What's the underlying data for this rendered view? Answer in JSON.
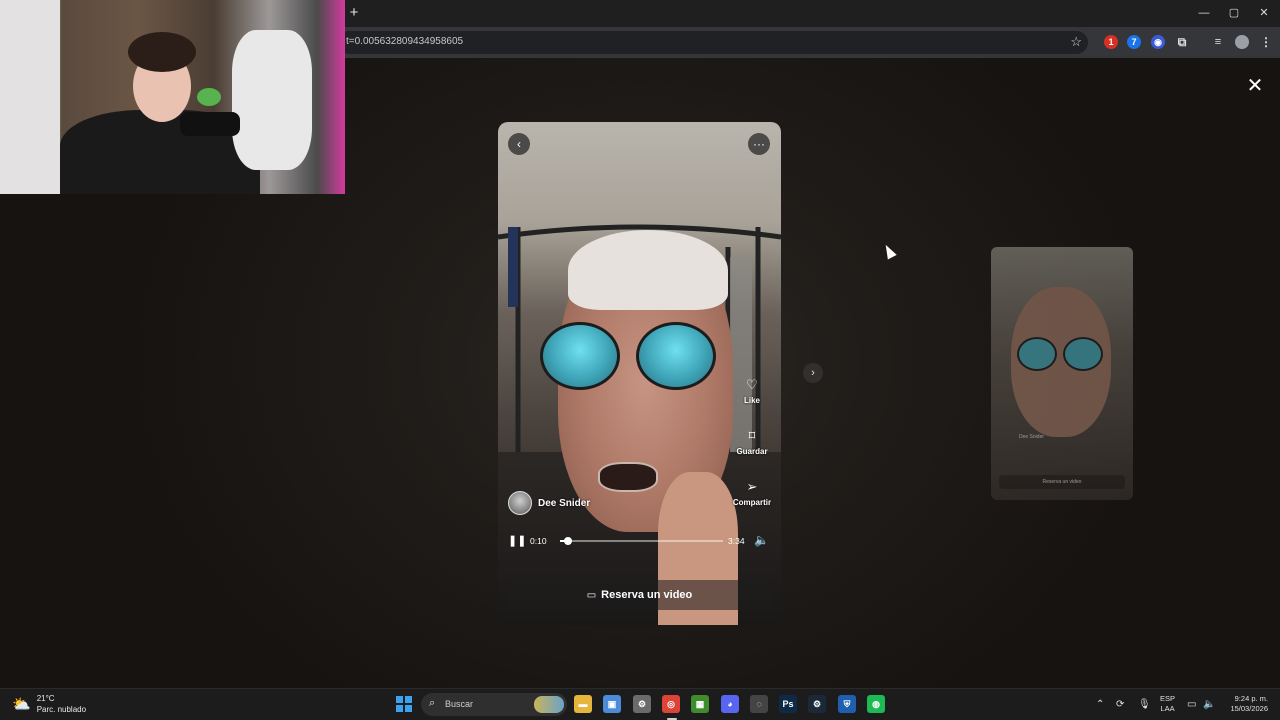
{
  "browser": {
    "new_tab": "+",
    "url": "t=0.005632809434958605",
    "window_controls": {
      "minimize": "—",
      "maximize": "▢",
      "close": "✕"
    },
    "extensions": [
      {
        "icon": "youtube-ext-icon",
        "color": "#d93025",
        "glyph": "1"
      },
      {
        "icon": "translate-ext-icon",
        "color": "#1a73e8",
        "glyph": "7"
      },
      {
        "icon": "shield-ext-icon",
        "color": "#3b5bd6",
        "glyph": "◉"
      }
    ]
  },
  "lightbox": {
    "close_glyph": "✕",
    "video": {
      "back_glyph": "‹",
      "more_glyph": "···",
      "author": "Dee Snider",
      "actions": [
        {
          "icon": "heart-icon",
          "glyph": "♡",
          "label": "Like"
        },
        {
          "icon": "bookmark-icon",
          "glyph": "⌑",
          "label": "Guardar"
        },
        {
          "icon": "send-icon",
          "glyph": "➢",
          "label": "Compartir"
        }
      ],
      "current_time": "0:10",
      "total_time": "3:34",
      "progress_fraction": 0.047,
      "play_state_glyph": "❚❚",
      "volume_glyph": "🔈",
      "cta_label": "Reserva un video",
      "cta_icon_glyph": "▭"
    },
    "next_arrow_glyph": "›",
    "next_preview": {
      "author": "Dee Snider",
      "cta_label": "Reserva un video"
    }
  },
  "taskbar": {
    "weather": {
      "temp": "21°C",
      "condition": "Parc. nublado",
      "icon_glyph": "⛅"
    },
    "search_label": "Buscar",
    "search_icon_glyph": "⌕",
    "apps": [
      {
        "name": "file-explorer-icon",
        "glyph": "▬",
        "color": "#e7b53b"
      },
      {
        "name": "store-icon",
        "glyph": "▣",
        "color": "#4c8bd8"
      },
      {
        "name": "settings-icon",
        "glyph": "⚙",
        "color": "#6b6b6b"
      },
      {
        "name": "chrome-icon",
        "glyph": "◎",
        "color": "#db4437"
      },
      {
        "name": "minecraft-icon",
        "glyph": "▦",
        "color": "#3f8c2c"
      },
      {
        "name": "discord-icon",
        "glyph": "◕",
        "color": "#5865f2"
      },
      {
        "name": "app-icon",
        "glyph": "◌",
        "color": "#444444"
      },
      {
        "name": "photoshop-icon",
        "glyph": "Ps",
        "color": "#0e2a47"
      },
      {
        "name": "steam-icon",
        "glyph": "⚙",
        "color": "#1b2838"
      },
      {
        "name": "vpn-icon",
        "glyph": "⛨",
        "color": "#1f5fb0"
      },
      {
        "name": "spotify-icon",
        "glyph": "◍",
        "color": "#1db954"
      }
    ],
    "tray": {
      "chevron_glyph": "⌃",
      "lang_top": "ESP",
      "lang_bottom": "LAA",
      "time": "9:24 p. m.",
      "date": "15/03/2026"
    }
  }
}
